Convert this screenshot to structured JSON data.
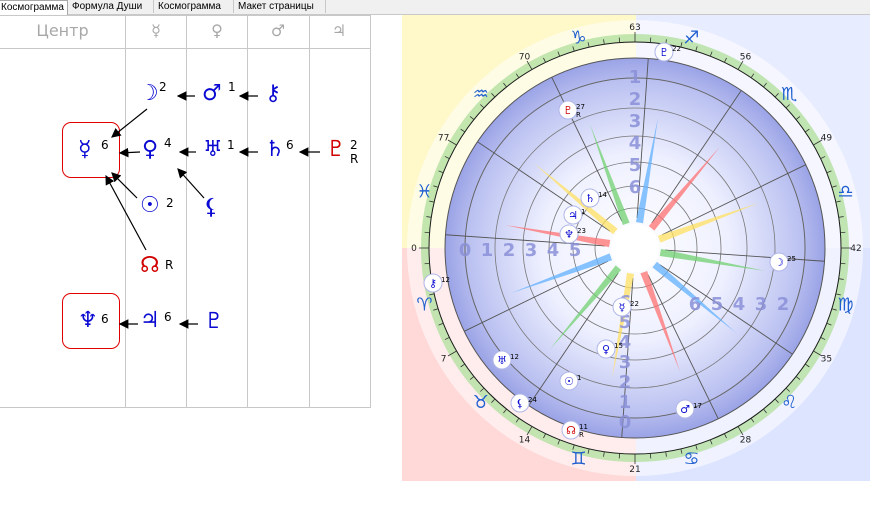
{
  "tabs": [
    {
      "label": "Космограмма",
      "active": true
    },
    {
      "label": "Формула Души",
      "active": false
    },
    {
      "label": "Космограмма",
      "active": false
    },
    {
      "label": "Макет страницы",
      "active": false
    }
  ],
  "grid": {
    "headers": [
      "Центр",
      "☿",
      "♀",
      "♂",
      "♃"
    ],
    "nodes": {
      "moon": {
        "glyph": "☽",
        "num": "2"
      },
      "mars": {
        "glyph": "♂",
        "num": "1"
      },
      "chiron": {
        "glyph": "⚷",
        "num": ""
      },
      "mercury": {
        "glyph": "☿",
        "num": "6"
      },
      "venus": {
        "glyph": "♀",
        "num": "4"
      },
      "uranus": {
        "glyph": "♅",
        "num": "1"
      },
      "saturn": {
        "glyph": "♄",
        "num": "6"
      },
      "pluto": {
        "glyph": "♇",
        "num": "2",
        "flag": "R"
      },
      "sun": {
        "glyph": "☉",
        "num": "2"
      },
      "lilith": {
        "glyph": "⚸",
        "num": ""
      },
      "node": {
        "glyph": "☊",
        "num": "",
        "flag": "R"
      },
      "neptune": {
        "glyph": "♆",
        "num": "6"
      },
      "jupiter": {
        "glyph": "♃",
        "num": "6"
      },
      "proserpina": {
        "glyph": "♇",
        "num": ""
      }
    }
  },
  "chart": {
    "degree_labels": [
      "63",
      "56",
      "49",
      "42",
      "35",
      "28",
      "21",
      "14",
      "7",
      "0",
      "77",
      "70"
    ],
    "signs": [
      "♐",
      "♏",
      "♎",
      "♍",
      "♌",
      "♋",
      "♊",
      "♉",
      "♈",
      "♓",
      "♒",
      "♑"
    ],
    "planets": [
      {
        "glyph": "♇",
        "deg": "22",
        "flag": ""
      },
      {
        "glyph": "♇",
        "deg": "27",
        "flag": "R"
      },
      {
        "glyph": "♄",
        "deg": "14",
        "flag": ""
      },
      {
        "glyph": "♃",
        "deg": "1",
        "flag": ""
      },
      {
        "glyph": "♆",
        "deg": "23",
        "flag": ""
      },
      {
        "glyph": "☽",
        "deg": "25",
        "flag": ""
      },
      {
        "glyph": "⚷",
        "deg": "12",
        "flag": ""
      },
      {
        "glyph": "☿",
        "deg": "22",
        "flag": ""
      },
      {
        "glyph": "♀",
        "deg": "15",
        "flag": ""
      },
      {
        "glyph": "♅",
        "deg": "12",
        "flag": ""
      },
      {
        "glyph": "☉",
        "deg": "1",
        "flag": ""
      },
      {
        "glyph": "⚸",
        "deg": "24",
        "flag": ""
      },
      {
        "glyph": "☊",
        "deg": "11",
        "flag": "R"
      },
      {
        "glyph": "♂",
        "deg": "17",
        "flag": ""
      }
    ],
    "house_numbers_top": [
      "1",
      "2",
      "3",
      "4",
      "5",
      "6"
    ],
    "house_numbers_left": [
      "0",
      "1",
      "2",
      "3",
      "4",
      "5"
    ],
    "house_numbers_right": [
      "6",
      "5",
      "4",
      "3",
      "2"
    ],
    "house_numbers_bottom": [
      "6",
      "5",
      "4",
      "3",
      "2",
      "1",
      "0"
    ],
    "colors": {
      "air": "#ffff80",
      "water": "#80c0ff",
      "fire": "#ff8080",
      "earth": "#80ff80"
    }
  }
}
